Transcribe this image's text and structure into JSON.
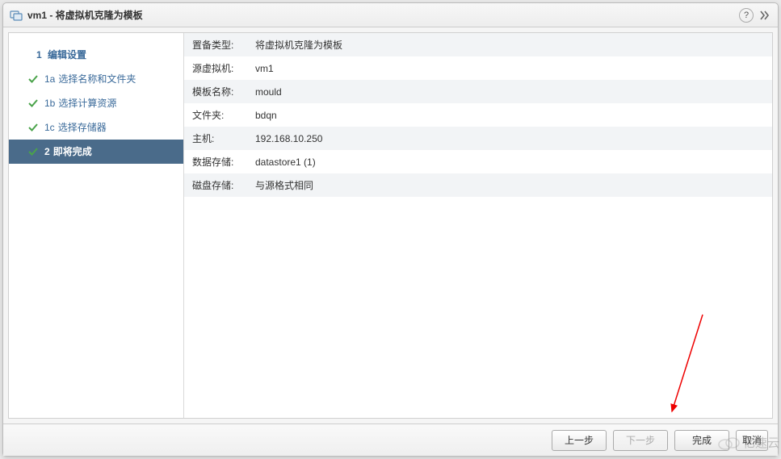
{
  "title": "vm1 - 将虚拟机克隆为模板",
  "sidebar": {
    "group1": {
      "num": "1",
      "label": "编辑设置"
    },
    "steps": [
      {
        "num": "1a",
        "label": "选择名称和文件夹",
        "done": true
      },
      {
        "num": "1b",
        "label": "选择计算资源",
        "done": true
      },
      {
        "num": "1c",
        "label": "选择存储器",
        "done": true
      }
    ],
    "active": {
      "num": "2",
      "label": "即将完成",
      "done": true
    }
  },
  "summary": [
    {
      "key": "置备类型:",
      "value": "将虚拟机克隆为模板"
    },
    {
      "key": "源虚拟机:",
      "value": "vm1"
    },
    {
      "key": "模板名称:",
      "value": "mould"
    },
    {
      "key": "文件夹:",
      "value": "bdqn"
    },
    {
      "key": "主机:",
      "value": "192.168.10.250"
    },
    {
      "key": "数据存储:",
      "value": "datastore1 (1)"
    },
    {
      "key": "磁盘存储:",
      "value": "与源格式相同"
    }
  ],
  "buttons": {
    "back": "上一步",
    "next": "下一步",
    "finish": "完成",
    "cancel": "取消"
  },
  "watermark": "亿速云"
}
